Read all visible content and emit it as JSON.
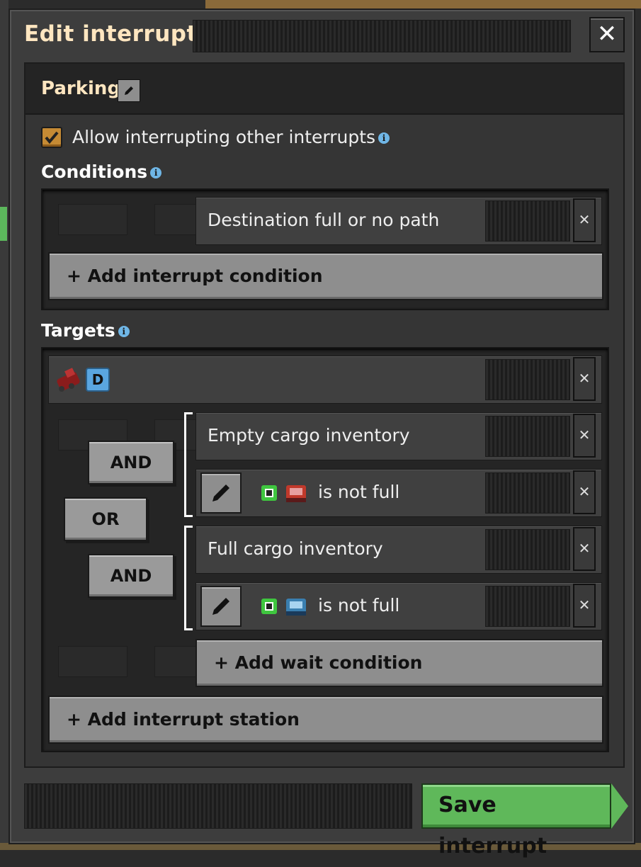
{
  "window": {
    "title": "Edit interrupt",
    "close_label": "✕"
  },
  "interrupt": {
    "name": "Parking"
  },
  "options": {
    "allow_interrupting_label": "Allow interrupting other interrupts",
    "allow_interrupting_checked": true
  },
  "conditions": {
    "heading": "Conditions",
    "items": [
      {
        "label": "Destination full or no path"
      }
    ],
    "add_label": "+ Add interrupt condition"
  },
  "targets": {
    "heading": "Targets",
    "station": {
      "badge": "D"
    },
    "logic": {
      "and1": "AND",
      "or": "OR",
      "and2": "AND"
    },
    "wait_conditions": [
      {
        "label": "Empty cargo inventory"
      },
      {
        "label": "is not full",
        "icon": "red-chest-icon"
      },
      {
        "label": "Full cargo inventory"
      },
      {
        "label": "is not full",
        "icon": "blue-chest-icon"
      }
    ],
    "add_wait_label": "+ Add wait condition",
    "add_station_label": "+ Add interrupt station"
  },
  "footer": {
    "save_label": "Save interrupt"
  },
  "colors": {
    "accent_green": "#5fb85a",
    "title_color": "#ffe6c0",
    "checkbox": "#c58a34"
  }
}
